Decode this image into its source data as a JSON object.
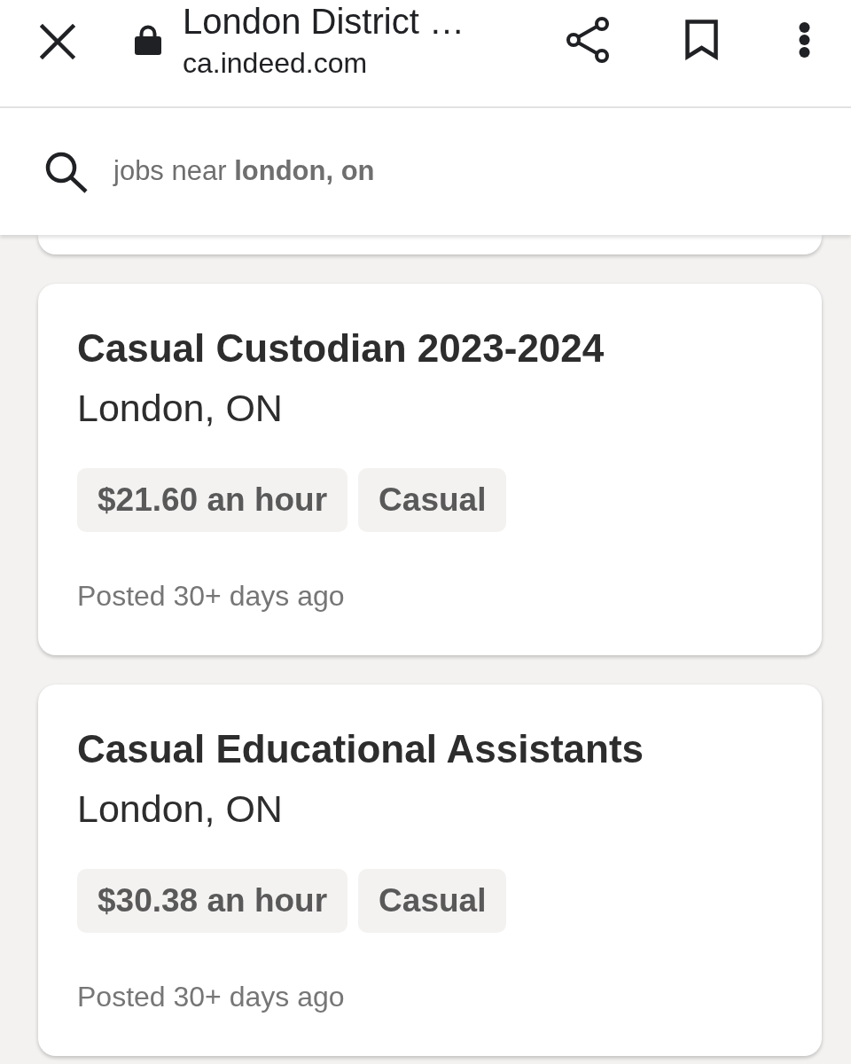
{
  "browser_bar": {
    "title": "London District …",
    "url": "ca.indeed.com"
  },
  "search": {
    "query": "jobs near **london, on**"
  },
  "jobs": [
    {
      "title": "Casual Custodian 2023-2024",
      "location": "London, ON",
      "tags": [
        "$21.60 an hour",
        "Casual"
      ],
      "posted": "Posted 30+ days ago"
    },
    {
      "title": "Casual Educational Assistants",
      "location": "London, ON",
      "tags": [
        "$30.38 an hour",
        "Casual"
      ],
      "posted": "Posted 30+ days ago"
    }
  ]
}
